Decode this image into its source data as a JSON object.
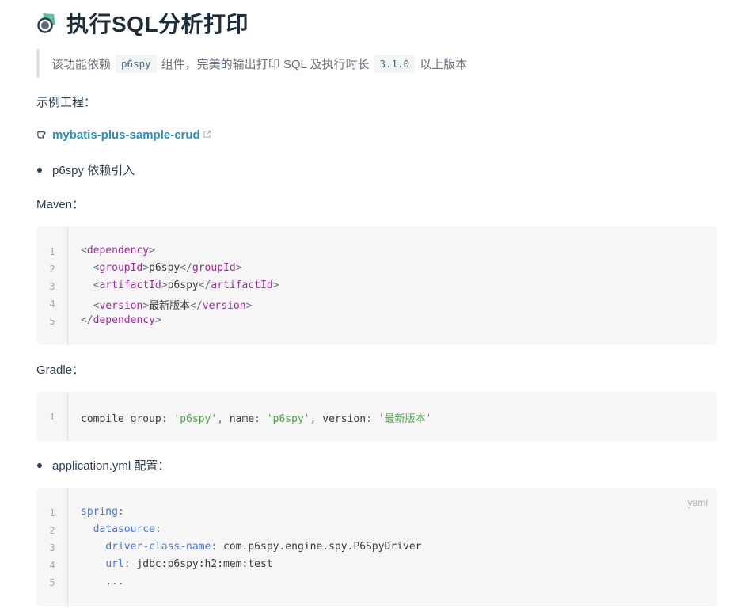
{
  "title": "执行SQL分析打印",
  "tip": {
    "before": "该功能依赖",
    "code1": "p6spy",
    "middle": "组件，完美的输出打印 SQL 及执行时长",
    "code2": "3.1.0",
    "after": "以上版本"
  },
  "example_label": "示例工程：",
  "example_link": "mybatis-plus-sample-crud",
  "bullet1": "p6spy 依赖引入",
  "maven_label": "Maven：",
  "maven_code": {
    "line_numbers": [
      "1",
      "2",
      "3",
      "4",
      "5"
    ],
    "l1": {
      "open": "<",
      "tag": "dependency",
      "close": ">"
    },
    "l2": {
      "tag_open": "groupId",
      "text": "p6spy",
      "tag_close": "groupId"
    },
    "l3": {
      "tag_open": "artifactId",
      "text": "p6spy",
      "tag_close": "artifactId"
    },
    "l4": {
      "tag_open": "version",
      "text": "最新版本",
      "tag_close": "version"
    },
    "l5": {
      "tag": "dependency"
    }
  },
  "gradle_label": "Gradle：",
  "gradle_code": {
    "line_numbers": [
      "1"
    ],
    "l1": {
      "a": "compile group",
      "b": "'p6spy'",
      "c": "name",
      "d": "'p6spy'",
      "e": "version",
      "f": "'最新版本'"
    }
  },
  "bullet2": "application.yml 配置：",
  "yaml_code": {
    "lang": "yaml",
    "line_numbers": [
      "1",
      "2",
      "3",
      "4",
      "5"
    ],
    "l1": "spring",
    "l2": "datasource",
    "l3": {
      "key": "driver-class-name",
      "val": "com.p6spy.engine.spy.P6SpyDriver"
    },
    "l4": {
      "key": "url",
      "val": "jdbc:p6spy:h2:mem:test"
    },
    "l5": "..."
  },
  "colors": {
    "accent": "#3eaf7c",
    "link": "#2b8fbd",
    "code_bg": "#f6f6f6"
  }
}
